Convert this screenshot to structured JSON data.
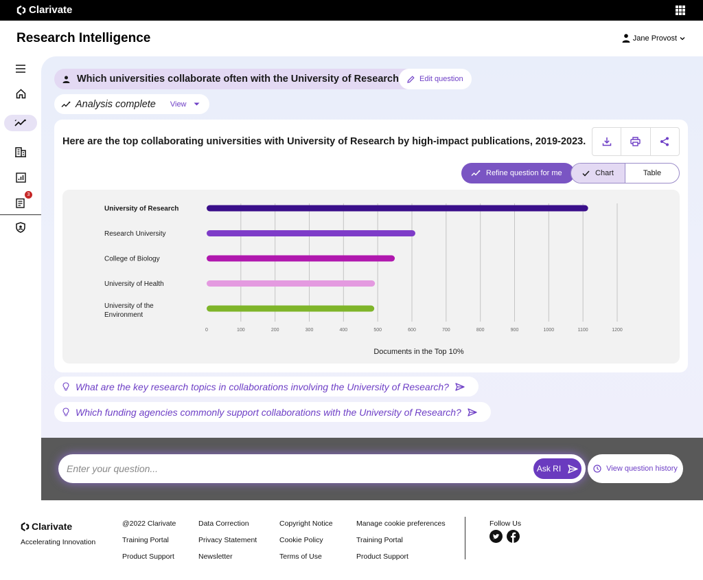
{
  "brand": {
    "name": "Clarivate"
  },
  "header": {
    "app_title": "Research Intelligence",
    "user_name": "Jane Provost"
  },
  "nav": {
    "items": [
      {
        "icon": "menu-icon"
      },
      {
        "icon": "home-icon"
      },
      {
        "icon": "analytics-icon",
        "active": true
      },
      {
        "icon": "building-icon"
      },
      {
        "icon": "report-chart-icon"
      },
      {
        "icon": "notes-icon",
        "badge": "3"
      },
      {
        "icon": "shield-icon"
      }
    ]
  },
  "conversation": {
    "question": "Which universities collaborate often with the University of Research?",
    "edit_label": "Edit question",
    "status": "Analysis complete",
    "view_label": "View",
    "answer_title": "Here are the top collaborating universities with University of Research by high-impact publications, 2019-2023.",
    "refine_label": "Refine question for me",
    "view_toggle": {
      "chart": "Chart",
      "table": "Table",
      "selected": "Chart"
    },
    "followups": [
      "What are the key research topics in collaborations involving the University of Research?",
      "Which funding agencies commonly support collaborations with the University of Research?"
    ]
  },
  "chart_data": {
    "type": "bar",
    "orientation": "horizontal",
    "categories": [
      "University of Research",
      "Research University",
      "College of Biology",
      "University of Health",
      "University of the Environment"
    ],
    "category_lines": [
      [
        "University of Research"
      ],
      [
        "Research University"
      ],
      [
        "College of Biology"
      ],
      [
        "University of Health"
      ],
      [
        "University of the",
        "Environment"
      ]
    ],
    "values": [
      1115,
      610,
      550,
      492,
      490
    ],
    "colors": [
      "#3a0f8a",
      "#7e3cc8",
      "#b018ae",
      "#e49ae0",
      "#7fb52a"
    ],
    "bold_first": true,
    "xlim": [
      0,
      1200
    ],
    "xticks": [
      0,
      100,
      200,
      300,
      400,
      500,
      600,
      700,
      800,
      900,
      1000,
      1100,
      1200
    ],
    "xlabel": "Documents in the Top 10%",
    "grid": true
  },
  "input": {
    "placeholder": "Enter your question...",
    "ask_label": "Ask RI",
    "history_label": "View question history"
  },
  "footer": {
    "brand": "Clarivate",
    "tagline": "Accelerating Innovation",
    "columns": [
      [
        "@2022 Clarivate",
        "Training Portal",
        "Product Support"
      ],
      [
        "Data Correction",
        "Privacy Statement",
        "Newsletter"
      ],
      [
        "Copyright Notice",
        "Cookie Policy",
        "Terms of Use"
      ],
      [
        "Manage cookie preferences",
        "Training Portal",
        "Product Support"
      ]
    ],
    "follow_label": "Follow Us",
    "social": [
      "twitter-icon",
      "facebook-icon"
    ]
  }
}
